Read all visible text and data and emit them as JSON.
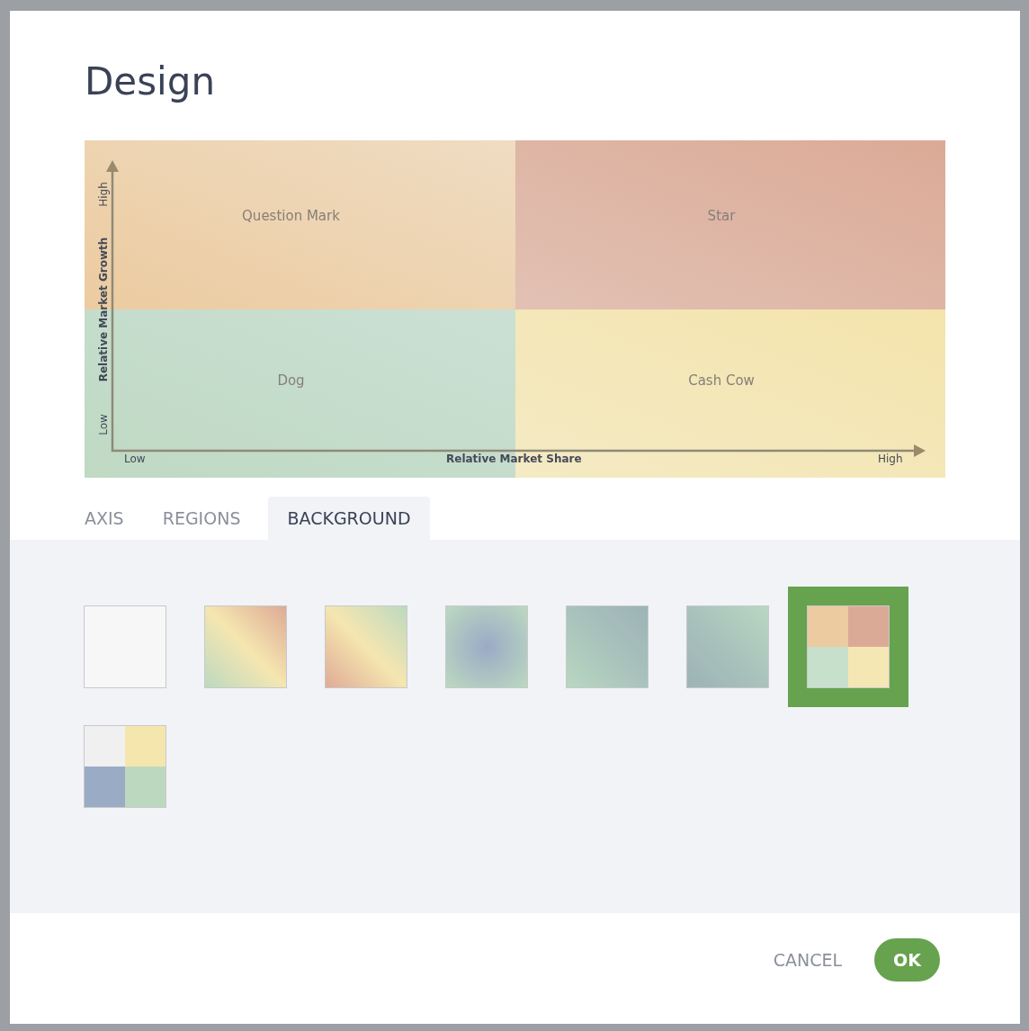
{
  "dialog": {
    "title": "Design"
  },
  "matrix": {
    "quadrants": [
      {
        "label": "Question Mark"
      },
      {
        "label": "Star"
      },
      {
        "label": "Dog"
      },
      {
        "label": "Cash Cow"
      }
    ],
    "y_axis": {
      "title": "Relative Market Growth",
      "low": "Low",
      "high": "High"
    },
    "x_axis": {
      "title": "Relative Market Share",
      "low": "Low",
      "high": "High"
    }
  },
  "tabs": [
    {
      "label": "AXIS",
      "selected": false
    },
    {
      "label": "REGIONS",
      "selected": false
    },
    {
      "label": "BACKGROUND",
      "selected": true
    }
  ],
  "swatches": [
    {
      "kind": "plain",
      "selected": false
    },
    {
      "kind": "warm-diagonal",
      "selected": false
    },
    {
      "kind": "warm-reverse",
      "selected": false
    },
    {
      "kind": "radial",
      "selected": false
    },
    {
      "kind": "teal-diagonal",
      "selected": false
    },
    {
      "kind": "teal-reverse",
      "selected": false
    },
    {
      "kind": "quad-regions",
      "selected": true
    },
    {
      "kind": "quad-pastel",
      "selected": false
    }
  ],
  "buttons": {
    "cancel": "CANCEL",
    "ok": "OK"
  }
}
